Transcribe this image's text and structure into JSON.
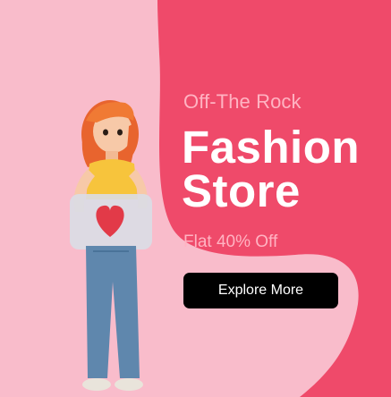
{
  "banner": {
    "eyebrow": "Off-The Rock",
    "headline_line1": "Fashion",
    "headline_line2": "Store",
    "offer": "Flat 40% Off",
    "cta_label": "Explore More"
  },
  "colors": {
    "background_light": "#f9bccb",
    "background_main": "#ef4a6a",
    "offer_text": "#ffb3c2",
    "button": "#000000",
    "button_text": "#ffffff"
  },
  "icons": {
    "heart": "heart-icon"
  }
}
